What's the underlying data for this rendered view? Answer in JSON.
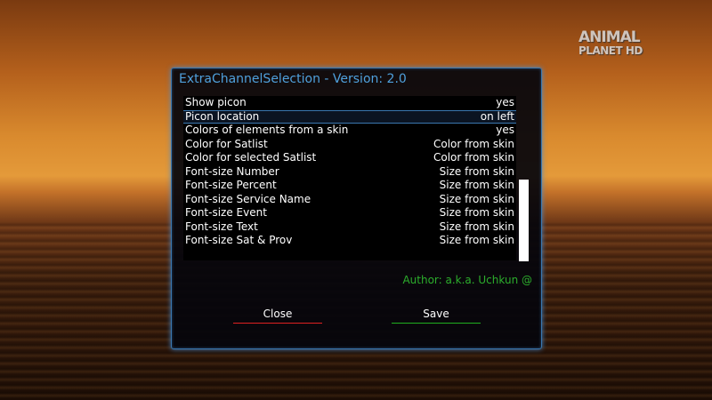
{
  "window": {
    "title": "ExtraChannelSelection - Version: 2.0"
  },
  "logo": {
    "line1": "ANIMAL",
    "line2": "PLANET HD"
  },
  "settings": [
    {
      "label": "Show picon",
      "value": "yes"
    },
    {
      "label": "Picon location",
      "value": "on left"
    },
    {
      "label": "Colors of elements from a skin",
      "value": "yes"
    },
    {
      "label": "Color for Satlist",
      "value": "Color from skin"
    },
    {
      "label": "Color for selected Satlist",
      "value": "Color from skin"
    },
    {
      "label": "Font-size Number",
      "value": "Size from skin"
    },
    {
      "label": "Font-size Percent",
      "value": "Size from skin"
    },
    {
      "label": "Font-size Service Name",
      "value": "Size from skin"
    },
    {
      "label": "Font-size Event",
      "value": "Size from skin"
    },
    {
      "label": "Font-size Text",
      "value": "Size from skin"
    },
    {
      "label": "Font-size Sat & Prov",
      "value": "Size from skin"
    }
  ],
  "author": "Author: a.k.a. Uchkun @",
  "buttons": {
    "close": "Close",
    "save": "Save"
  },
  "colors": {
    "title": "#4fa0dc",
    "author": "#2cae2c",
    "close_underline": "#e02020",
    "save_underline": "#1fae1f",
    "frame": "#3a78b0"
  }
}
